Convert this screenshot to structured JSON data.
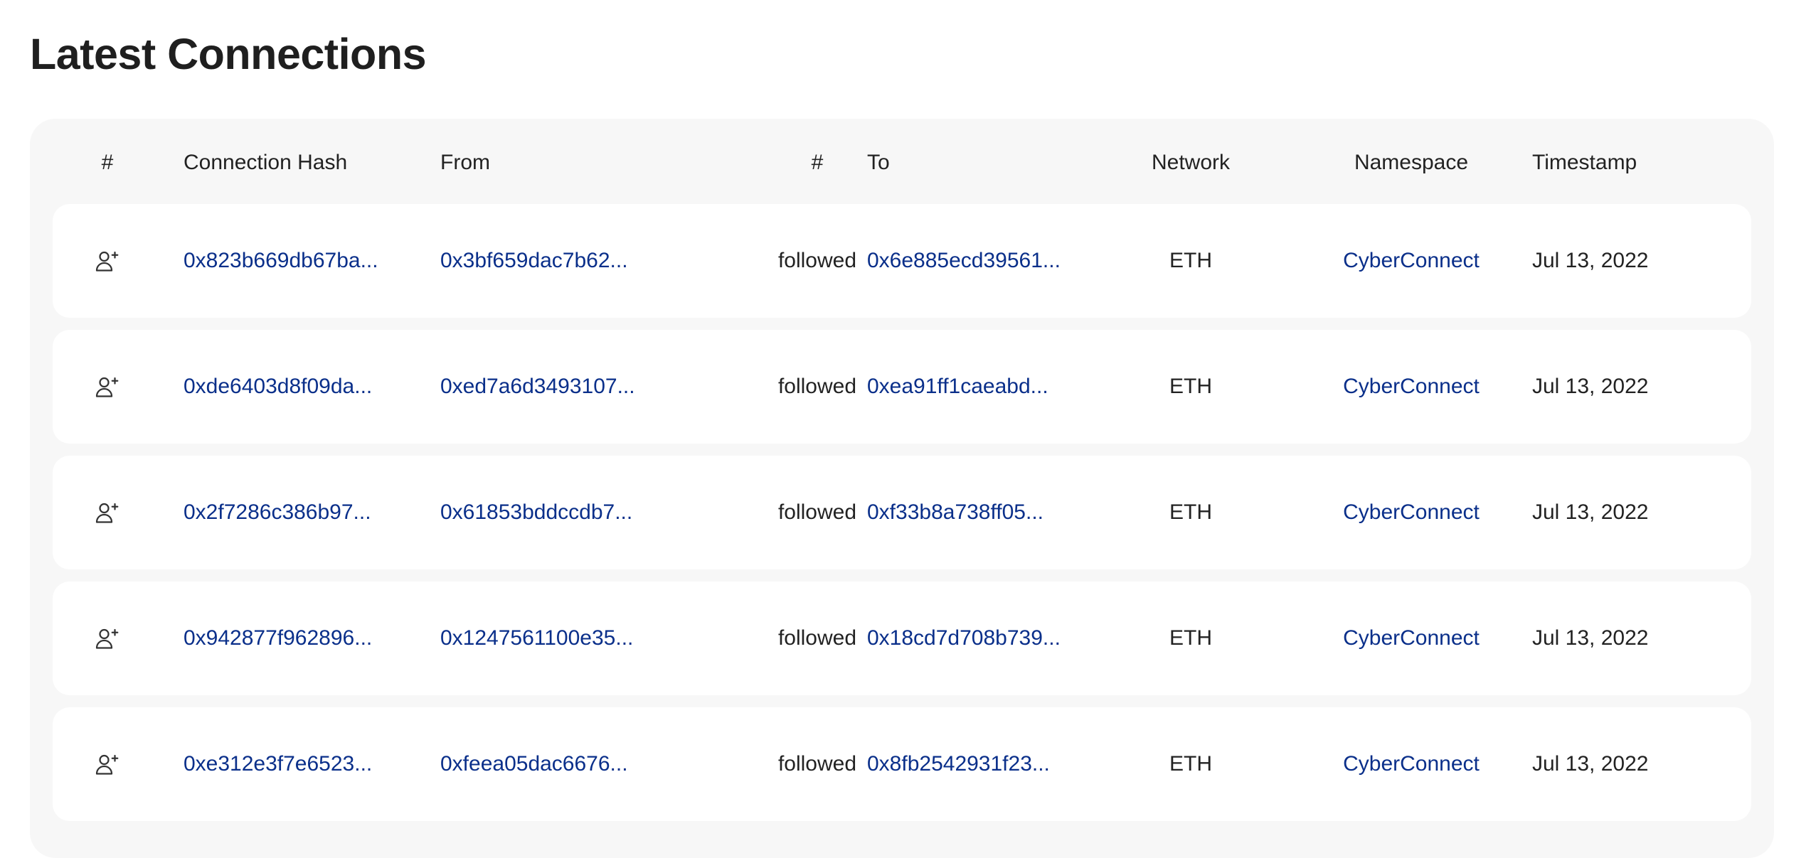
{
  "page": {
    "title": "Latest Connections"
  },
  "table": {
    "headers": {
      "icon": "#",
      "hash": "Connection Hash",
      "from": "From",
      "action": "#",
      "to": "To",
      "network": "Network",
      "namespace": "Namespace",
      "timestamp": "Timestamp"
    },
    "rows": [
      {
        "icon": "user-plus-icon",
        "hash": "0x823b669db67ba...",
        "from": "0x3bf659dac7b62...",
        "action": "followed",
        "to": "0x6e885ecd39561...",
        "network": "ETH",
        "namespace": "CyberConnect",
        "timestamp": "Jul 13, 2022"
      },
      {
        "icon": "user-plus-icon",
        "hash": "0xde6403d8f09da...",
        "from": "0xed7a6d3493107...",
        "action": "followed",
        "to": "0xea91ff1caeabd...",
        "network": "ETH",
        "namespace": "CyberConnect",
        "timestamp": "Jul 13, 2022"
      },
      {
        "icon": "user-plus-icon",
        "hash": "0x2f7286c386b97...",
        "from": "0x61853bddccdb7...",
        "action": "followed",
        "to": "0xf33b8a738ff05...",
        "network": "ETH",
        "namespace": "CyberConnect",
        "timestamp": "Jul 13, 2022"
      },
      {
        "icon": "user-plus-icon",
        "hash": "0x942877f962896...",
        "from": "0x1247561100e35...",
        "action": "followed",
        "to": "0x18cd7d708b739...",
        "network": "ETH",
        "namespace": "CyberConnect",
        "timestamp": "Jul 13, 2022"
      },
      {
        "icon": "user-plus-icon",
        "hash": "0xe312e3f7e6523...",
        "from": "0xfeea05dac6676...",
        "action": "followed",
        "to": "0x8fb2542931f23...",
        "network": "ETH",
        "namespace": "CyberConnect",
        "timestamp": "Jul 13, 2022"
      }
    ]
  },
  "colors": {
    "link": "#0a2f8a",
    "panel_background": "#f7f7f7",
    "row_background": "#ffffff",
    "text": "#222222"
  }
}
